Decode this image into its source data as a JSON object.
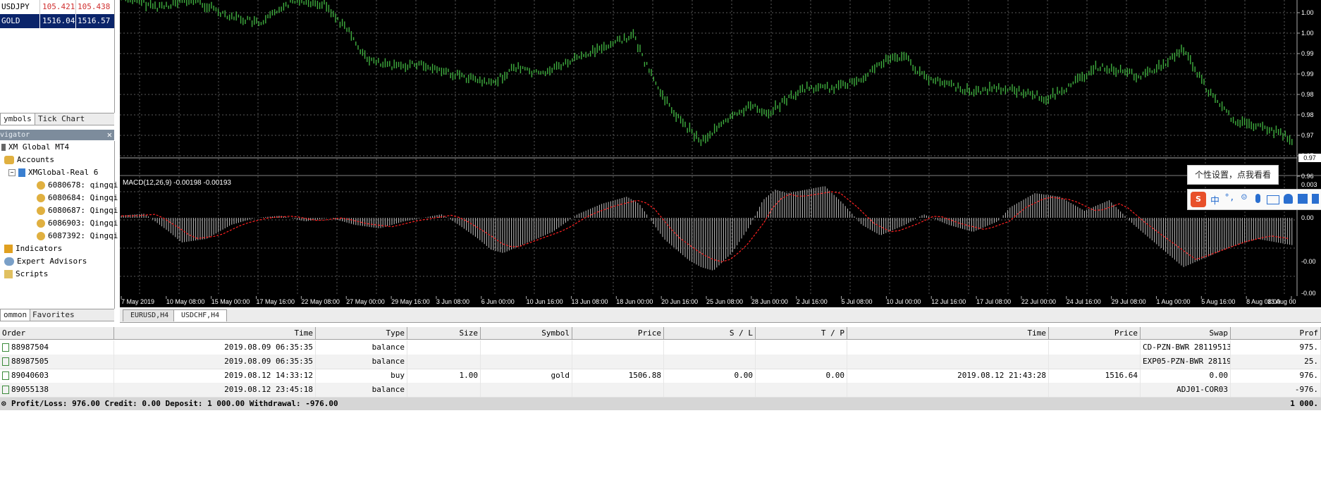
{
  "market_watch": {
    "rows": [
      {
        "symbol": "USDJPY",
        "bid": "105.421",
        "ask": "105.438"
      },
      {
        "symbol": "GOLD",
        "bid": "1516.04",
        "ask": "1516.57"
      }
    ],
    "tabs": [
      "ymbols",
      "Tick Chart"
    ]
  },
  "navigator": {
    "title": "vigator",
    "root": "XM Global MT4",
    "accounts": "Accounts",
    "server": "XMGlobal-Real 6",
    "account_list": [
      "6080678: qingqi",
      "6080684: Qingqi",
      "6080687: Qingqi",
      "6086903: Qingqi",
      "6087392: Qingqi"
    ],
    "indicators": "Indicators",
    "experts": "Expert Advisors",
    "scripts": "Scripts",
    "tabs": [
      "ommon",
      "Favorites"
    ]
  },
  "chart": {
    "macd_label": "MACD(12,26,9) -0.00198 -0.00193",
    "price_current": "0.97",
    "price_ticks": [
      "1.00",
      "1.00",
      "0.99",
      "0.99",
      "0.98",
      "0.98",
      "0.97",
      "0.97",
      "0.96"
    ],
    "macd_ticks": [
      "0.003",
      "0.00",
      "-0.00",
      "-0.00"
    ],
    "time_ticks": [
      "7 May 2019",
      "10 May 08:00",
      "15 May 00:00",
      "17 May 16:00",
      "22 May 08:00",
      "27 May 00:00",
      "29 May 16:00",
      "3 Jun 08:00",
      "6 Jun 00:00",
      "10 Jun 16:00",
      "13 Jun 08:00",
      "18 Jun 00:00",
      "20 Jun 16:00",
      "25 Jun 08:00",
      "28 Jun 00:00",
      "2 Jul 16:00",
      "5 Jul 08:00",
      "10 Jul 00:00",
      "12 Jul 16:00",
      "17 Jul 08:00",
      "22 Jul 00:00",
      "24 Jul 16:00",
      "29 Jul 08:00",
      "1 Aug 00:00",
      "5 Aug 16:00",
      "8 Aug 08:00",
      "13 Aug 00"
    ],
    "colors": {
      "bg": "#000000",
      "candle": "#3fae3f",
      "macd_hist": "#c0c0c0",
      "signal": "#ff2020",
      "grid": "#5a5a5a"
    }
  },
  "chart_tabs": [
    "EURUSD,H4",
    "USDCHF,H4"
  ],
  "terminal": {
    "columns": [
      "Order",
      "Time",
      "Type",
      "Size",
      "Symbol",
      "Price",
      "S / L",
      "T / P",
      "Time",
      "Price",
      "Swap",
      "Prof"
    ],
    "rows": [
      {
        "order": "88987504",
        "time": "2019.08.09 06:35:35",
        "type": "balance",
        "size": "",
        "symbol": "",
        "price": "",
        "sl": "",
        "tp": "",
        "close_time": "",
        "close_price": "",
        "swap": "CD-PZN-BWR 28119513",
        "profit": "975."
      },
      {
        "order": "88987505",
        "time": "2019.08.09 06:35:35",
        "type": "balance",
        "size": "",
        "symbol": "",
        "price": "",
        "sl": "",
        "tp": "",
        "close_time": "",
        "close_price": "",
        "swap": "EXP05-PZN-BWR 28119513",
        "profit": "25."
      },
      {
        "order": "89040603",
        "time": "2019.08.12 14:33:12",
        "type": "buy",
        "size": "1.00",
        "symbol": "gold",
        "price": "1506.88",
        "sl": "0.00",
        "tp": "0.00",
        "close_time": "2019.08.12 21:43:28",
        "close_price": "1516.64",
        "swap": "0.00",
        "profit": "976."
      },
      {
        "order": "89055138",
        "time": "2019.08.12 23:45:18",
        "type": "balance",
        "size": "",
        "symbol": "",
        "price": "",
        "sl": "",
        "tp": "",
        "close_time": "",
        "close_price": "",
        "swap": "ADJ01-COR03",
        "profit": "-976."
      }
    ],
    "summary": "Profit/Loss: 976.00  Credit: 0.00  Deposit: 1 000.00  Withdrawal: -976.00",
    "summary_right": "1 000."
  },
  "tooltip": "个性设置，点我看看",
  "ime": {
    "logo": "S",
    "mode": "中"
  }
}
